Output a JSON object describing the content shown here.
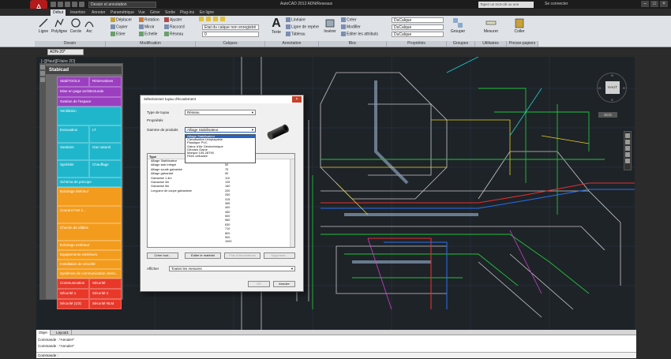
{
  "titlebar": {
    "workspace": "Dessin et annotation",
    "title": "AutoCAD 2012 ADN/Reseaux",
    "search_placeholder": "Tapez un mot-clé ou une expression",
    "user": "Se connecter",
    "buttons": [
      "–",
      "□",
      "×"
    ]
  },
  "ribbon": {
    "tabs": [
      "Début",
      "Insertion",
      "Annoter",
      "Paramétrique",
      "Vue",
      "Gérer",
      "Sortie",
      "Plug-ins",
      "En ligne"
    ],
    "active_tab": "Début",
    "draw": {
      "line": "Ligne",
      "polyline": "Polyligne",
      "circle": "Cercle",
      "arc": "Arc"
    },
    "modify": {
      "move": "Déplacer",
      "copy": "Copier",
      "stretch": "Etirer",
      "rotate": "Rotation",
      "mirror": "Miroir",
      "scale": "Echelle",
      "trim": "Ajuster",
      "fillet": "Raccord",
      "array": "Réseau"
    },
    "layers": {
      "current": "Etat du calque non enregistré",
      "layer_zero": "0"
    },
    "annotation": {
      "text": "Texte",
      "linear": "Linéaire",
      "leader": "Ligne de repère",
      "table": "Tableau"
    },
    "block": {
      "insert": "Insérer",
      "create": "Créer",
      "edit": "Modifier",
      "edit_attributes": "Editer les attributs"
    },
    "properties": {
      "color": "DuCalque",
      "linetype": "DuCalque",
      "lineweight": "DuCalque"
    },
    "groups": {
      "group": "Grouper"
    },
    "utilities": {
      "measure": "Mesurer"
    },
    "clipboard": {
      "paste": "Coller"
    },
    "panels": [
      "Dessin",
      "Modification",
      "Calques",
      "Annotation",
      "Bloc",
      "Propriétés",
      "Groupes",
      "Utilitaires",
      "Presse-papiers"
    ]
  },
  "drawing": {
    "tab": "ADN-20*",
    "view_label": "[–][Haut][Filaire 2D]",
    "viewcube": {
      "face": "HAUT",
      "n": "N",
      "s": "S",
      "e": "E",
      "w": "O"
    },
    "wcs": "SCG"
  },
  "palette": {
    "title": "Stabicad",
    "rows": [
      {
        "cells": [
          "StabiTOOLS",
          "Réservations"
        ],
        "color": "#9b3fc0"
      },
      {
        "cells": [
          "Mise en page architecturale"
        ],
        "color": "#9b3fc0"
      },
      {
        "cells": [
          "Gestion de l'espace"
        ],
        "color": "#9b3fc0"
      },
      {
        "cells": [
          "Ventilation"
        ],
        "color": "#1fb6cc"
      },
      {
        "cells": [
          "Evacuation",
          "LT"
        ],
        "color": "#1fb6cc"
      },
      {
        "cells": [
          "Sanitaire",
          "Gaz naturel"
        ],
        "color": "#1fb6cc"
      },
      {
        "cells": [
          "Sprinkler",
          "Chauffage"
        ],
        "color": "#1fb6cc"
      },
      {
        "cells": [
          "Schéma de principe"
        ],
        "color": "#1fb6cc"
      },
      {
        "cells": [
          "Eclairage intérieur"
        ],
        "color": "#f39b1c"
      },
      {
        "cells": [
          "Courant Fort 2..."
        ],
        "color": "#f39b1c"
      },
      {
        "cells": [
          "Chemin de câbles"
        ],
        "color": "#f39b1c"
      },
      {
        "cells": [
          "Eclairage extérieur"
        ],
        "color": "#f39b1c"
      },
      {
        "cells": [
          "Equipements extérieurs"
        ],
        "color": "#f39b1c"
      },
      {
        "cells": [
          "Installation de sécurité"
        ],
        "color": "#f39b1c"
      },
      {
        "cells": [
          "Systèmes de communication intern..."
        ],
        "color": "#f39b1c"
      },
      {
        "cells": [
          "Communication",
          "Sécurité"
        ],
        "color": "#e8382a"
      },
      {
        "cells": [
          "Sécurité 1",
          "Sécurité 2"
        ],
        "color": "#e8382a"
      },
      {
        "cells": [
          "Sécurité (1/2)",
          "Sécurité NLM"
        ],
        "color": "#e8382a"
      }
    ]
  },
  "dialog": {
    "title": "Sélectionnez tuyau d'écoulement",
    "close": "×",
    "type_label": "Type de tuyau",
    "type_value": "Réseau",
    "properties_label": "Propriétés",
    "group_label": "Gamme de produits",
    "group_value": "Alliage Stabilisateur",
    "dropdown_options": [
      "Alliage Stabilisateur",
      "Canalisation remplaçable",
      "Plastique PVC",
      "Gaine d'Air Géotechnique",
      "Géodes Gaine",
      "Marque 105-28790",
      "Fibre cellulaire"
    ],
    "dropdown_selected": 0,
    "list_header": [
      "Type",
      "Diam."
    ],
    "list_rows": [
      {
        "name": "Alliage Stabilisateur",
        "value": "40"
      },
      {
        "name": "Alliage stab intégré",
        "value": "50"
      },
      {
        "name": "Alliage soudé galvanisé",
        "value": "75"
      },
      {
        "name": "Alliage galvanisé",
        "value": "90"
      },
      {
        "name": "Galvanisé 1-4m",
        "value": "110"
      },
      {
        "name": "Galvanisé 3m",
        "value": "125"
      },
      {
        "name": "Galvanisé 5m",
        "value": "160"
      },
      {
        "name": "Longueur de coupe galvanisée",
        "value": "200"
      },
      {
        "name": "",
        "value": "250"
      },
      {
        "name": "",
        "value": "315"
      },
      {
        "name": "",
        "value": "355"
      },
      {
        "name": "",
        "value": "400"
      },
      {
        "name": "",
        "value": "450"
      },
      {
        "name": "",
        "value": "500"
      },
      {
        "name": "",
        "value": "560"
      },
      {
        "name": "",
        "value": "630"
      },
      {
        "name": "",
        "value": "710"
      },
      {
        "name": "",
        "value": "800"
      },
      {
        "name": "",
        "value": "900"
      },
      {
        "name": "",
        "value": "1000"
      }
    ],
    "buttons": {
      "new": "Créer tout...",
      "edit_material": "Editer le matériel",
      "add_to_favorites": "Plus d'informations",
      "delete": "Supprimer..."
    },
    "show_label": "Afficher",
    "show_value": "Toutes les mesures",
    "ok": "OK",
    "cancel": "Annuler"
  },
  "layout_tabs": [
    "Objet",
    "Layout1"
  ],
  "command": {
    "history": [
      "Commande : *Annuler*",
      "Commande : *Annuler*"
    ],
    "prompt": "Commande :"
  }
}
